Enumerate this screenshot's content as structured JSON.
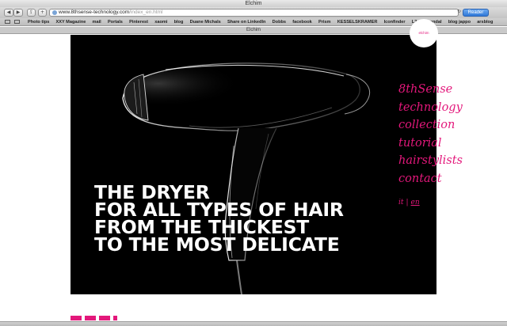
{
  "window": {
    "title": "Elchim"
  },
  "toolbar": {
    "back_icon": "back-arrow-icon",
    "forward_icon": "forward-arrow-icon",
    "add_icon": "plus-icon",
    "share_icon": "share-icon",
    "url_main": "www.8thsense-technology.com",
    "url_path": "/index_en.html",
    "reader_label": "Reader"
  },
  "bookmarks": {
    "items": [
      "Photo tips",
      "XXY Magazine",
      "mail",
      "Portals",
      "Pinterest",
      "xaomi",
      "blog",
      "Duane Michals",
      "Share on LinkedIn",
      "Dobbs",
      "facebook",
      "Prism",
      "KESSELSKRAMER",
      "Iconfinder",
      "L2",
      "rozendal",
      "blog jappo",
      "arsblog"
    ]
  },
  "tab": {
    "title": "Elchim"
  },
  "hero": {
    "headline": [
      "THE DRYER",
      "FOR ALL TYPES OF HAIR",
      "FROM THE THICKEST",
      "TO THE MOST DELICATE"
    ],
    "image": "hair-dryer-photo"
  },
  "badge": {
    "label": "elchim"
  },
  "nav": {
    "items": [
      "8thSense",
      "technology",
      "collection",
      "tutorial",
      "hairstylists",
      "contact"
    ]
  },
  "lang": {
    "it": "it",
    "sep": "|",
    "en": "en"
  },
  "colors": {
    "accent": "#e3187b",
    "hero_bg": "#000000",
    "headline": "#ffffff"
  }
}
